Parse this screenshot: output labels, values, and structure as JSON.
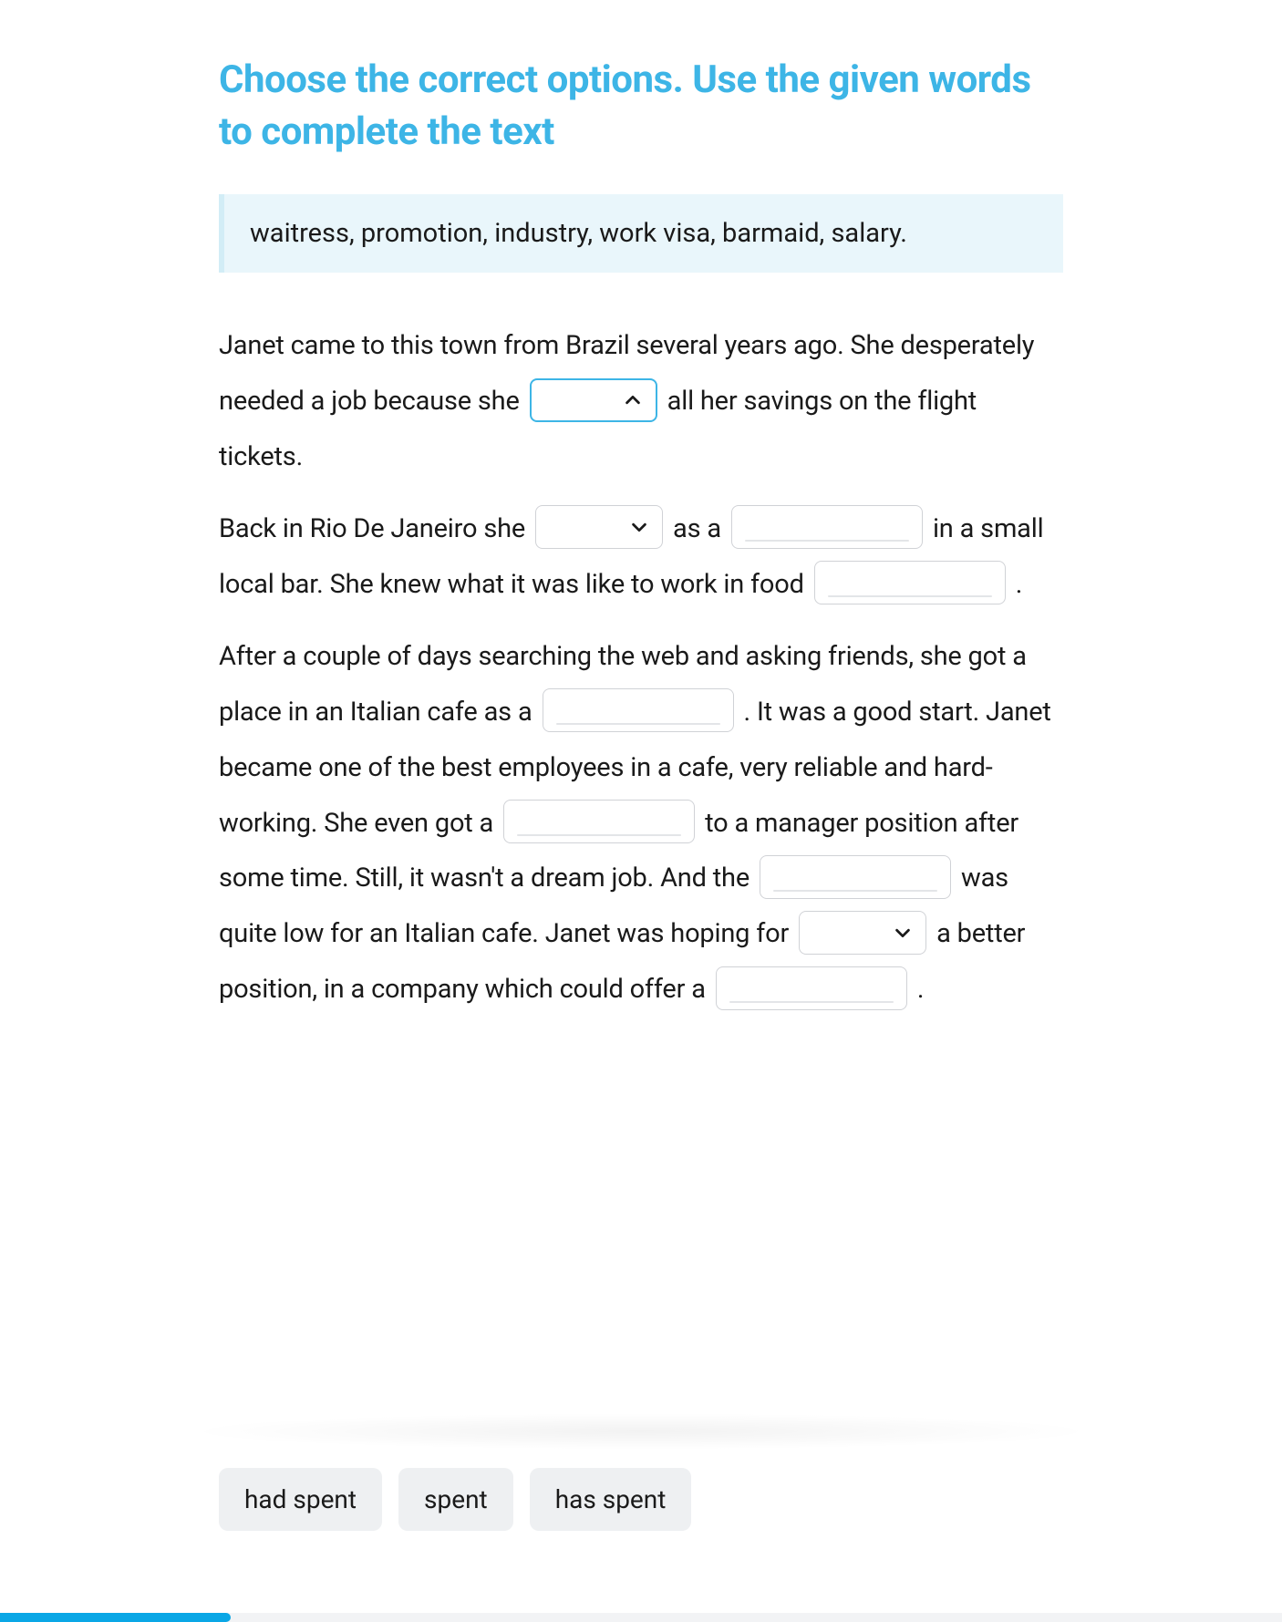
{
  "title": "Choose the correct options. Use the given words to complete the text",
  "word_bank": "waitress, promotion, industry, work visa, barmaid, salary.",
  "passage": {
    "p1": {
      "t1": "Janet came to this town from Brazil several years ago. She desperately needed a job because she ",
      "t2": " all her savings on the flight tickets."
    },
    "p2": {
      "t1": "Back in Rio De Janeiro she ",
      "t2": " as a ",
      "t3": " in a small local bar. She knew what it was like to work in food ",
      "t4": " ."
    },
    "p3": {
      "t1": "After a couple of days searching the web and asking friends, she got a place in an Italian cafe as a ",
      "t2": ". It was a good start. Janet became one of the best employees in a cafe, very reliable and hard-working. She even got a ",
      "t3": " to a manager position after some time. Still, it wasn't a dream job. And the ",
      "t4": " was quite low for an Italian cafe. Janet was hoping for ",
      "t5": " a better position, in a company which could offer a ",
      "t6": "."
    }
  },
  "blanks": {
    "b1": {
      "kind": "select",
      "state": "open",
      "value": ""
    },
    "b2": {
      "kind": "select",
      "state": "closed",
      "value": ""
    },
    "b3": {
      "kind": "input",
      "value": ""
    },
    "b4": {
      "kind": "input",
      "value": ""
    },
    "b5": {
      "kind": "input",
      "value": ""
    },
    "b6": {
      "kind": "input",
      "value": ""
    },
    "b7": {
      "kind": "input",
      "value": ""
    },
    "b8": {
      "kind": "select",
      "state": "closed",
      "value": ""
    },
    "b9": {
      "kind": "input",
      "value": ""
    }
  },
  "options_for_open_select": [
    "had spent",
    "spent",
    "has spent"
  ],
  "progress_percent": 18
}
